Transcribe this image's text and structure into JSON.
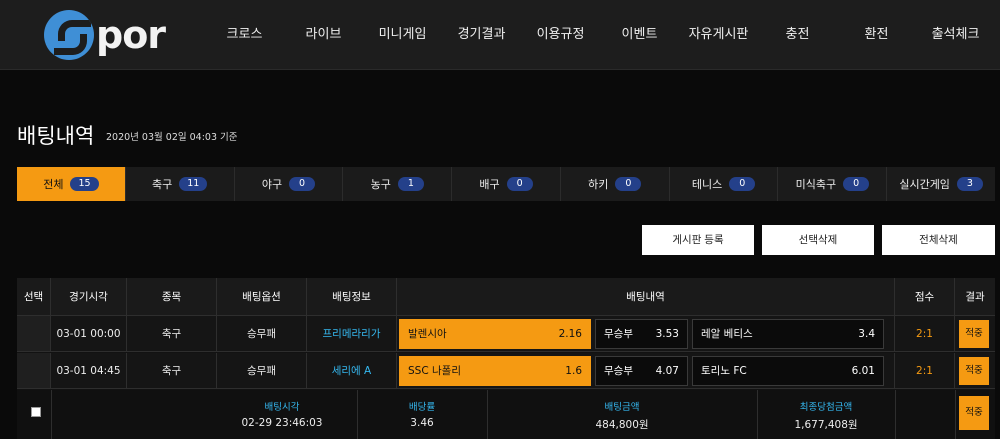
{
  "logo": {
    "text": "por"
  },
  "nav": [
    "크로스",
    "라이브",
    "미니게임",
    "경기결과",
    "이용규정",
    "이벤트",
    "자유게시판",
    "충전",
    "환전",
    "출석체크"
  ],
  "page": {
    "title": "배팅내역",
    "date": "2020년 03월 02일 04:03 기준"
  },
  "tabs": [
    {
      "label": "전체",
      "count": "15",
      "active": true
    },
    {
      "label": "축구",
      "count": "11"
    },
    {
      "label": "야구",
      "count": "0"
    },
    {
      "label": "농구",
      "count": "1"
    },
    {
      "label": "배구",
      "count": "0"
    },
    {
      "label": "하키",
      "count": "0"
    },
    {
      "label": "테니스",
      "count": "0"
    },
    {
      "label": "미식축구",
      "count": "0"
    },
    {
      "label": "실시간게임",
      "count": "3"
    }
  ],
  "buttons": {
    "post": "게시판 등록",
    "delete_selected": "선택삭제",
    "delete_all": "전체삭제"
  },
  "table": {
    "headers": {
      "select": "선택",
      "time": "경기시각",
      "sport": "종목",
      "option": "배팅옵션",
      "info": "배팅정보",
      "detail": "배팅내역",
      "score": "점수",
      "result": "결과"
    },
    "rows": [
      {
        "time": "03-01 00:00",
        "sport": "축구",
        "option": "승무패",
        "league": "프리메라리가",
        "home": "발렌시아",
        "home_odds": "2.16",
        "draw": "무승부",
        "draw_odds": "3.53",
        "away": "레알 베티스",
        "away_odds": "3.4",
        "score": "2:1",
        "result": "적중"
      },
      {
        "time": "03-01 04:45",
        "sport": "축구",
        "option": "승무패",
        "league": "세리에 A",
        "home": "SSC 나폴리",
        "home_odds": "1.6",
        "draw": "무승부",
        "draw_odds": "4.07",
        "away": "토리노 FC",
        "away_odds": "6.01",
        "score": "2:1",
        "result": "적중"
      }
    ],
    "summary": {
      "bet_time_label": "배팅시각",
      "bet_time": "02-29 23:46:03",
      "odds_label": "배당률",
      "odds": "3.46",
      "amount_label": "배팅금액",
      "amount": "484,800원",
      "payout_label": "최종당첨금액",
      "payout": "1,677,408원",
      "result": "적중"
    }
  },
  "colors": {
    "accent": "#f59a12",
    "badge": "#24408a",
    "league": "#35b8f0",
    "logo": "#3f8fd6"
  }
}
